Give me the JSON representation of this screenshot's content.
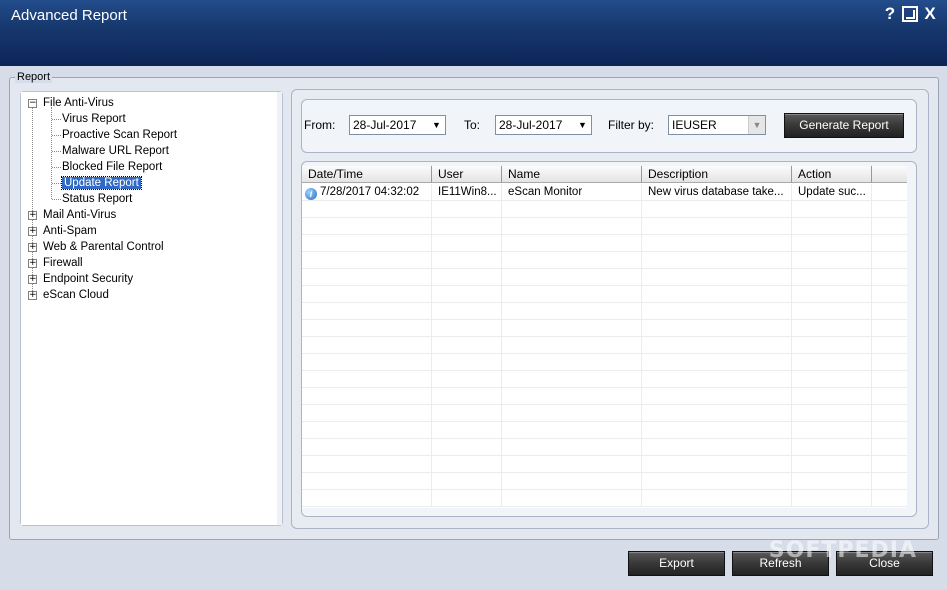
{
  "window": {
    "title": "Advanced Report",
    "help_glyph": "?",
    "close_glyph": "X"
  },
  "group": {
    "label": "Report"
  },
  "tree": {
    "nodes": [
      {
        "label": "File Anti-Virus",
        "expanded": true,
        "level": 0
      },
      {
        "label": "Virus Report",
        "level": 1
      },
      {
        "label": "Proactive Scan Report",
        "level": 1
      },
      {
        "label": "Malware URL Report",
        "level": 1
      },
      {
        "label": "Blocked File Report",
        "level": 1
      },
      {
        "label": "Update Report",
        "level": 1,
        "selected": true
      },
      {
        "label": "Status Report",
        "level": 1
      },
      {
        "label": "Mail Anti-Virus",
        "expanded": false,
        "level": 0
      },
      {
        "label": "Anti-Spam",
        "expanded": false,
        "level": 0
      },
      {
        "label": "Web & Parental Control",
        "expanded": false,
        "level": 0
      },
      {
        "label": "Firewall",
        "expanded": false,
        "level": 0
      },
      {
        "label": "Endpoint Security",
        "expanded": false,
        "level": 0
      },
      {
        "label": "eScan Cloud",
        "expanded": false,
        "level": 0
      }
    ]
  },
  "filters": {
    "from_label": "From:",
    "from_value": "28-Jul-2017",
    "to_label": "To:",
    "to_value": "28-Jul-2017",
    "filter_label": "Filter by:",
    "filter_value": "IEUSER",
    "generate_label": "Generate Report",
    "arrow_glyph": "▼"
  },
  "table": {
    "columns": [
      "Date/Time",
      "User",
      "Name",
      "Description",
      "Action"
    ],
    "rows": [
      [
        "7/28/2017 04:32:02",
        "IE11Win8...",
        "eScan Monitor",
        "New virus database take...",
        "Update suc..."
      ]
    ],
    "info_glyph": "i"
  },
  "footer": {
    "export_label": "Export",
    "refresh_label": "Refresh",
    "close_label": "Close"
  },
  "watermark": "SOFTPEDIA",
  "colors": {
    "titlebar": "#17386e",
    "selection": "#316ac5",
    "background": "#d6dde8"
  }
}
